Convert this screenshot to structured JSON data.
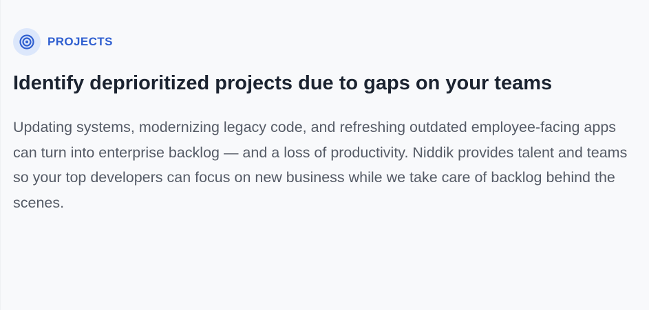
{
  "section": {
    "eyebrow": {
      "icon": "target-icon",
      "label": "PROJECTS"
    },
    "headline": "Identify deprioritized projects due to gaps on your teams",
    "body": "Updating systems, modernizing legacy code, and refreshing outdated employee-facing apps can turn into enterprise backlog — and a loss of productivity. Niddik provides talent and teams so your top developers can focus on new business while we take care of backlog behind the scenes."
  },
  "colors": {
    "background": "#f8f9fb",
    "accent": "#2f5fd0",
    "icon_badge": "#dce7fb",
    "headline": "#1b2330",
    "body_text": "#555b66"
  }
}
